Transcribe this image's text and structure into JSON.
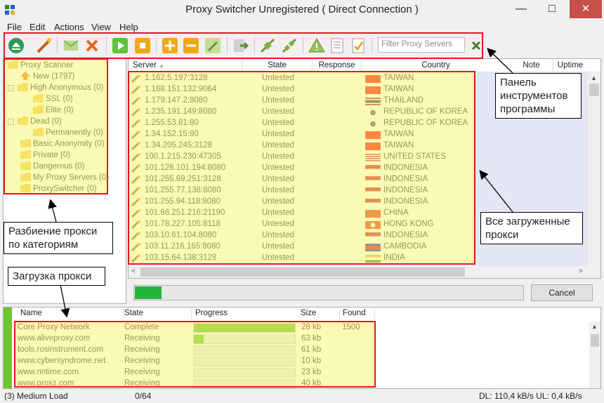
{
  "window": {
    "title": "Proxy Switcher Unregistered ( Direct Connection )"
  },
  "menu": [
    "File",
    "Edit",
    "Actions",
    "View",
    "Help"
  ],
  "toolbar": {
    "filter_placeholder": "Filter Proxy Servers",
    "buttons": [
      "eject-icon",
      "magic-wand-icon",
      "envelope-icon",
      "delete-icon",
      "play-icon",
      "stop-icon",
      "add-icon",
      "remove-icon",
      "edit-icon",
      "export-icon",
      "connect-icon",
      "disconnect-icon",
      "warning-icon",
      "list-icon",
      "checklist-icon",
      "clear-filter-icon"
    ]
  },
  "tree": {
    "items": [
      "Proxy Scanner",
      "New (1797)",
      "High Anonymous (0)",
      "SSL (0)",
      "Elite (0)",
      "Dead (0)",
      "Permanently (0)",
      "Basic Anonymity (0)",
      "Private (0)",
      "Dangerous (0)",
      "My Proxy Servers (0)",
      "ProxySwitcher (0)"
    ]
  },
  "servers": {
    "columns": {
      "server": "Server",
      "state": "State",
      "response": "Response",
      "country": "Country",
      "note": "Note",
      "uptime": "Uptime"
    },
    "rows": [
      {
        "server": "1.162.5.197:3128",
        "state": "Untested",
        "country": "TAIWAN"
      },
      {
        "server": "1.168.151.132:9064",
        "state": "Untested",
        "country": "TAIWAN"
      },
      {
        "server": "1.179.147.2:8080",
        "state": "Untested",
        "country": "THAILAND"
      },
      {
        "server": "1.235.191.149:8080",
        "state": "Untested",
        "country": "REPUBLIC OF KOREA"
      },
      {
        "server": "1.255.53.81:80",
        "state": "Untested",
        "country": "REPUBLIC OF KOREA"
      },
      {
        "server": "1.34.152.15:80",
        "state": "Untested",
        "country": "TAIWAN"
      },
      {
        "server": "1.34.205.245:3128",
        "state": "Untested",
        "country": "TAIWAN"
      },
      {
        "server": "100.1.215.230:47305",
        "state": "Untested",
        "country": "UNITED STATES"
      },
      {
        "server": "101.128.101.194:8080",
        "state": "Untested",
        "country": "INDONESIA"
      },
      {
        "server": "101.255.69.251:3128",
        "state": "Untested",
        "country": "INDONESIA"
      },
      {
        "server": "101.255.77.138:8080",
        "state": "Untested",
        "country": "INDONESIA"
      },
      {
        "server": "101.255.94.118:8080",
        "state": "Untested",
        "country": "INDONESIA"
      },
      {
        "server": "101.66.251.216:21190",
        "state": "Untested",
        "country": "CHINA"
      },
      {
        "server": "101.78.227.105:8118",
        "state": "Untested",
        "country": "HONG KONG"
      },
      {
        "server": "103.10.61.104:8080",
        "state": "Untested",
        "country": "INDONESIA"
      },
      {
        "server": "103.11.216.165:8080",
        "state": "Untested",
        "country": "CAMBODIA"
      },
      {
        "server": "103.15.64.138:3128",
        "state": "Untested",
        "country": "INDIA"
      }
    ]
  },
  "scan_progress": 0.068,
  "cancel_label": "Cancel",
  "downloads": {
    "columns": {
      "name": "Name",
      "state": "State",
      "progress": "Progress",
      "size": "Size",
      "found": "Found"
    },
    "rows": [
      {
        "name": "Core Proxy Network",
        "state": "Complete",
        "progress": 1.0,
        "size": "28 kb",
        "found": "1500"
      },
      {
        "name": "www.aliveproxy.com",
        "state": "Receiving",
        "progress": 0.1,
        "size": "63 kb",
        "found": ""
      },
      {
        "name": "tools.rosinstrument.com",
        "state": "Receiving",
        "progress": 0,
        "size": "61 kb",
        "found": ""
      },
      {
        "name": "www.cybersyndrome.net",
        "state": "Receiving",
        "progress": 0,
        "size": "10 kb",
        "found": ""
      },
      {
        "name": "www.nntime.com",
        "state": "Receiving",
        "progress": 0,
        "size": "23 kb",
        "found": ""
      },
      {
        "name": "www.proxz.com",
        "state": "Receiving",
        "progress": 0,
        "size": "40 kb",
        "found": ""
      }
    ]
  },
  "status": {
    "load": "(3) Medium Load",
    "count": "0/64",
    "speed": "DL: 110,4 kB/s UL: 0,4 kB/s"
  },
  "callouts": {
    "toolbar": "Панель инструментов программы",
    "categories": "Разбиение прокси по категориям",
    "loading": "Загрузка прокси",
    "all_proxies": "Все загруженные прокси"
  },
  "colors": {
    "highlight_border": "#e8151f",
    "highlight_fill": "#f8f678",
    "progress_green": "#22b53b",
    "folder": "#f2c94c"
  }
}
